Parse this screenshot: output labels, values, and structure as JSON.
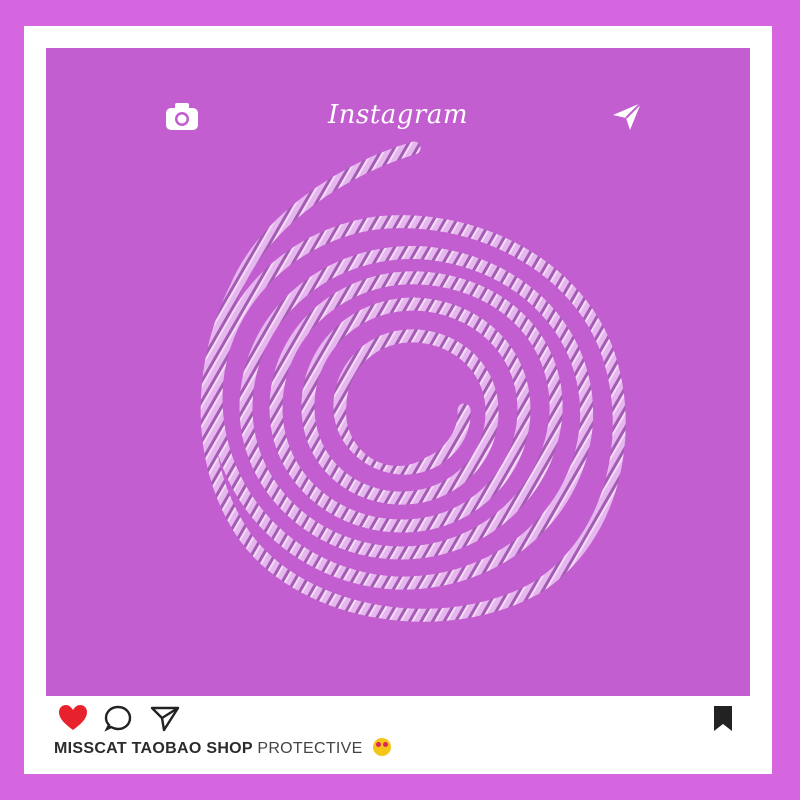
{
  "post": {
    "brand": "Instagram",
    "caption_shop": "MISSCAT TAOBAO SHOP",
    "caption_text": "PROTECTIVE",
    "caption_emoji": "heart-eyes-emoji"
  },
  "icons": {
    "camera": "camera-icon",
    "send": "send-icon",
    "like": "heart-icon",
    "comment": "comment-icon",
    "share": "share-icon",
    "save": "bookmark-icon"
  },
  "colors": {
    "background": "#d566e0",
    "photo": "#c25ecf",
    "coil": "#e8b8f0",
    "like": "#e8222c"
  }
}
